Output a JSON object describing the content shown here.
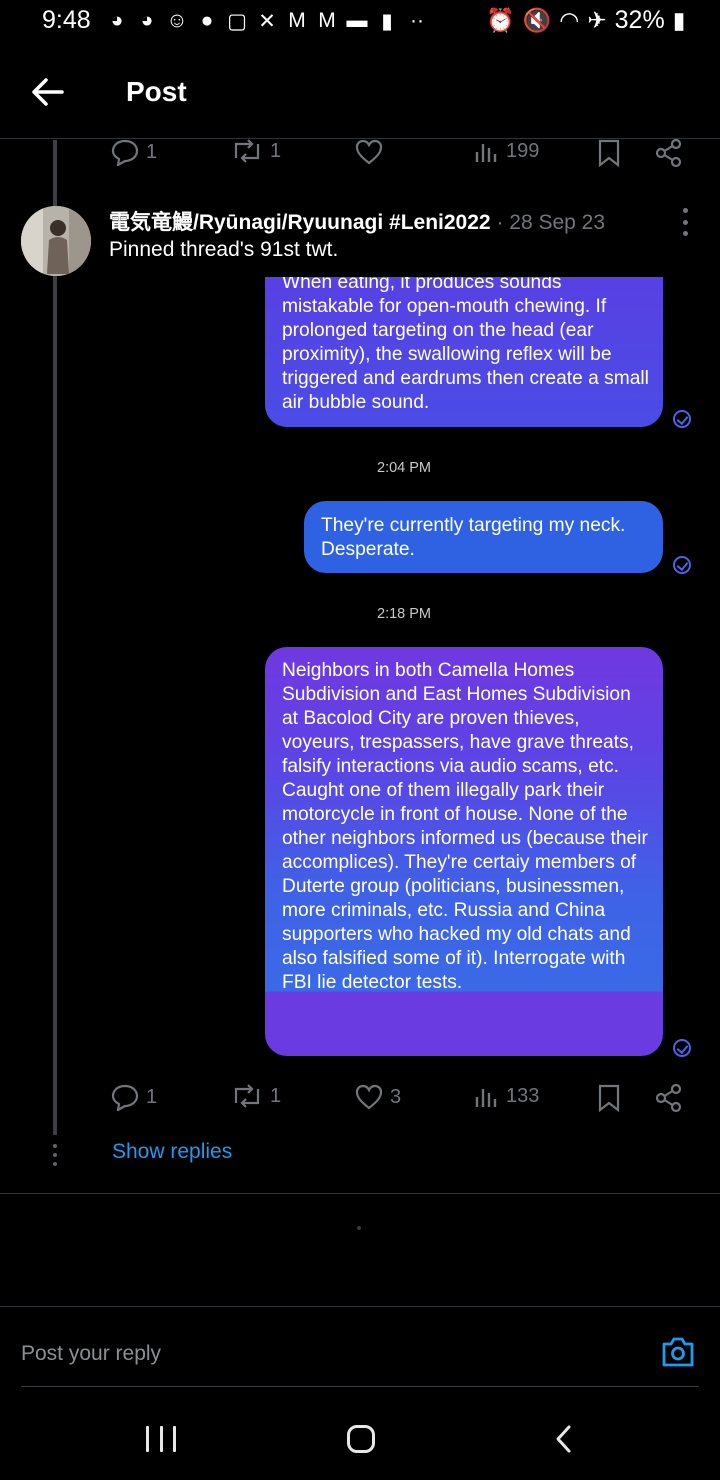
{
  "status_bar": {
    "time": "9:48",
    "app_icons": [
      "messenger-icon",
      "messenger-icon",
      "account-icon",
      "reddit-icon",
      "twitch-icon",
      "x-icon",
      "gmail-icon",
      "gmail-icon",
      "chat-icon",
      "person-icon",
      "more-dots-icon"
    ],
    "battery": "32%"
  },
  "header": {
    "title": "Post"
  },
  "prev_actions": {
    "replies": "1",
    "reposts": "1",
    "likes": "",
    "views": "199"
  },
  "tweet": {
    "author": "電気竜鰻/Ryūnagi/Ryuunagi #Leni2022",
    "date": "· 28 Sep 23",
    "text": "Pinned thread's 91st twt.",
    "screenshot": {
      "bubble1": "When eating, it produces sounds mistakable for open-mouth chewing. If prolonged targeting on the head (ear proximity), the swallowing reflex will be triggered and eardrums then create a small air bubble sound.",
      "time1": "2:04 PM",
      "bubble2": "They're currently targeting my neck. Desperate.",
      "time2": "2:18 PM",
      "bubble3": "Neighbors in both Camella Homes Subdivision and East Homes Subdivision at Bacolod City are proven thieves, voyeurs, trespassers, have grave threats, falsify interactions via audio scams, etc. Caught one of them illegally park their motorcycle in front of house. None of the other neighbors informed us (because their accomplices). They're certaiy members of Duterte group (politicians, businessmen, more criminals, etc. Russia and China supporters who hacked my old chats and also falsified some of it). Interrogate with FBI lie detector tests."
    },
    "actions": {
      "replies": "1",
      "reposts": "1",
      "likes": "3",
      "views": "133"
    }
  },
  "show_replies": "Show replies",
  "reply": {
    "placeholder": "Post your reply"
  },
  "colors": {
    "accent": "#1d9bf0",
    "background": "#000000",
    "muted": "#71767b",
    "bubble": "#5147e6"
  }
}
